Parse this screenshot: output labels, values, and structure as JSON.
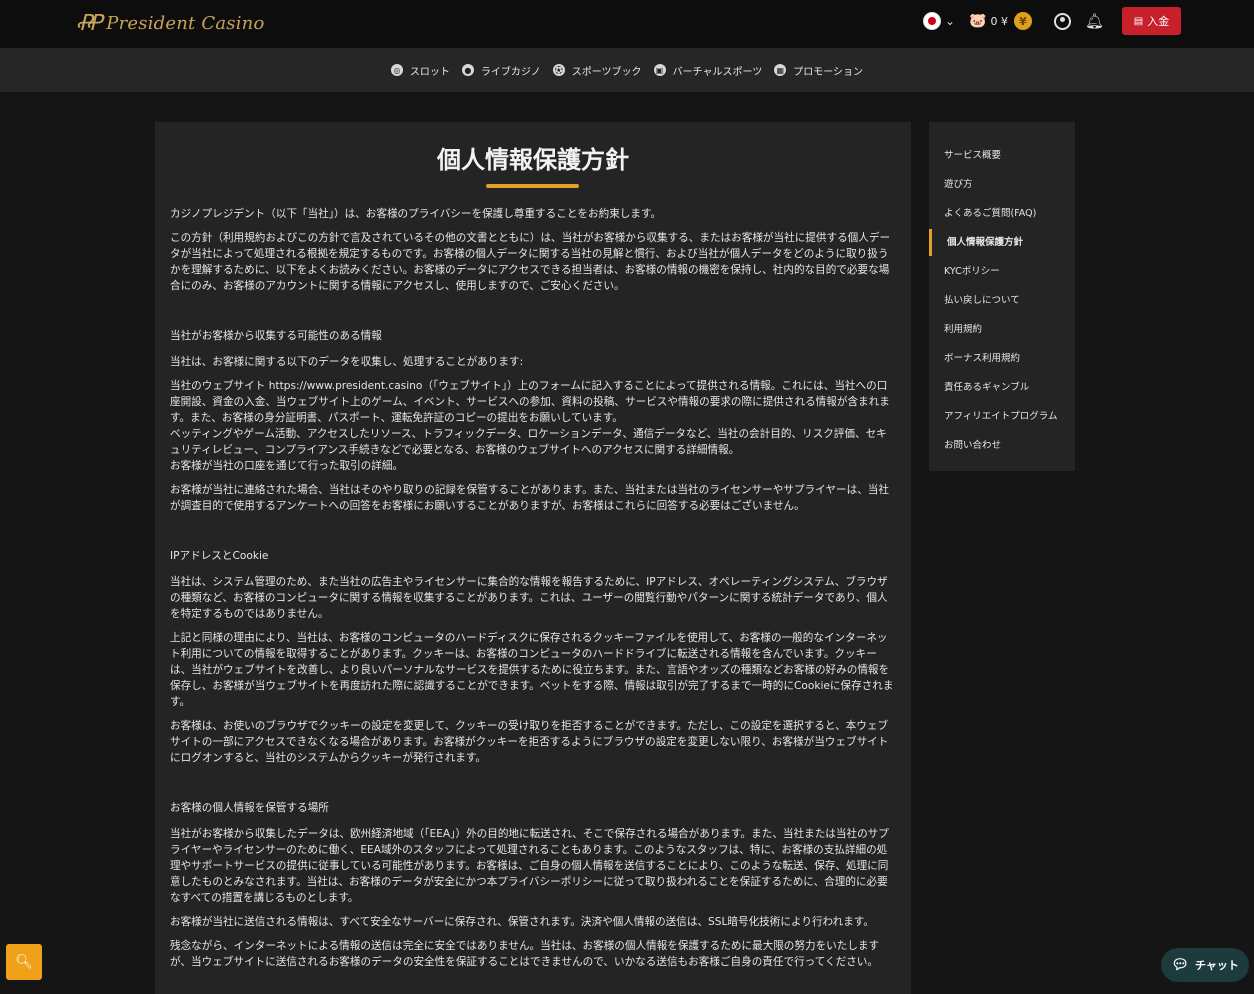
{
  "header": {
    "logo_mark": "ꝒꝒ",
    "logo_text": "President Casino",
    "language_flag": "japan-flag-icon",
    "balance": "0 ¥",
    "coin_symbol": "¥",
    "deposit_label": "入金"
  },
  "nav": {
    "items": [
      {
        "label": "スロット",
        "icon": "slot-icon"
      },
      {
        "label": "ライブカジノ",
        "icon": "live-casino-icon"
      },
      {
        "label": "スポーツブック",
        "icon": "sportsbook-icon"
      },
      {
        "label": "バーチャルスポーツ",
        "icon": "virtual-sports-icon"
      },
      {
        "label": "プロモーション",
        "icon": "promotion-icon"
      }
    ]
  },
  "article": {
    "title": "個人情報保護方針",
    "p1": "カジノプレジデント（以下「当社」）は、お客様のプライバシーを保護し尊重することをお約束します。",
    "p2": "この方針（利用規約およびこの方針で言及されているその他の文書とともに）は、当社がお客様から収集する、またはお客様が当社に提供する個人データが当社によって処理される根拠を規定するものです。お客様の個人データに関する当社の見解と慣行、および当社が個人データをどのように取り扱うかを理解するために、以下をよくお読みください。お客様のデータにアクセスできる担当者は、お客様の情報の機密を保持し、社内的な目的で必要な場合にのみ、お客様のアカウントに関する情報にアクセスし、使用しますので、ご安心ください。",
    "h1": "当社がお客様から収集する可能性のある情報",
    "p3": "当社は、お客様に関する以下のデータを収集し、処理することがあります:",
    "p4a": "当社のウェブサイト https://www.president.casino（「ウェブサイト」）上のフォームに記入することによって提供される情報。これには、当社への口座開設、資金の入金、当ウェブサイト上のゲーム、イベント、サービスへの参加、資料の投稿、サービスや情報の要求の際に提供される情報が含まれます。また、お客様の身分証明書、パスポート、運転免許証のコピーの提出をお願いしています。",
    "p4b": "ベッティングやゲーム活動、アクセスしたリソース、トラフィックデータ、ロケーションデータ、通信データなど、当社の会計目的、リスク評価、セキュリティレビュー、コンプライアンス手続きなどで必要となる、お客様のウェブサイトへのアクセスに関する詳細情報。",
    "p4c": "お客様が当社の口座を通じて行った取引の詳細。",
    "p5": "お客様が当社に連絡された場合、当社はそのやり取りの記録を保管することがあります。また、当社または当社のライセンサーやサプライヤーは、当社が調査目的で使用するアンケートへの回答をお客様にお願いすることがありますが、お客様はこれらに回答する必要はございません。",
    "h2": "IPアドレスとCookie",
    "p6": "当社は、システム管理のため、また当社の広告主やライセンサーに集合的な情報を報告するために、IPアドレス、オペレーティングシステム、ブラウザの種類など、お客様のコンピュータに関する情報を収集することがあります。これは、ユーザーの閲覧行動やパターンに関する統計データであり、個人を特定するものではありません。",
    "p7": "上記と同様の理由により、当社は、お客様のコンピュータのハードディスクに保存されるクッキーファイルを使用して、お客様の一般的なインターネット利用についての情報を取得することがあります。クッキーは、お客様のコンピュータのハードドライブに転送される情報を含んでいます。クッキーは、当社がウェブサイトを改善し、より良いパーソナルなサービスを提供するために役立ちます。また、言語やオッズの種類などお客様の好みの情報を保存し、お客様が当ウェブサイトを再度訪れた際に認識することができます。ベットをする際、情報は取引が完了するまで一時的にCookieに保存されます。",
    "p8": "お客様は、お使いのブラウザでクッキーの設定を変更して、クッキーの受け取りを拒否することができます。ただし、この設定を選択すると、本ウェブサイトの一部にアクセスできなくなる場合があります。お客様がクッキーを拒否するようにブラウザの設定を変更しない限り、お客様が当ウェブサイトにログオンすると、当社のシステムからクッキーが発行されます。",
    "h3": "お客様の個人情報を保管する場所",
    "p9": "当社がお客様から収集したデータは、欧州経済地域（「EEA」）外の目的地に転送され、そこで保存される場合があります。また、当社または当社のサプライヤーやライセンサーのために働く、EEA域外のスタッフによって処理されることもあります。このようなスタッフは、特に、お客様の支払詳細の処理やサポートサービスの提供に従事している可能性があります。お客様は、ご自身の個人情報を送信することにより、このような転送、保存、処理に同意したものとみなされます。当社は、お客様のデータが安全にかつ本プライバシーポリシーに従って取り扱われることを保証するために、合理的に必要なすべての措置を講じるものとします。",
    "p10": "お客様が当社に送信される情報は、すべて安全なサーバーに保存され、保管されます。決済や個人情報の送信は、SSL暗号化技術により行われます。",
    "p11": "残念ながら、インターネットによる情報の送信は完全に安全ではありません。当社は、お客様の個人情報を保護するために最大限の努力をいたしますが、当ウェブサイトに送信されるお客様のデータの安全性を保証することはできませんので、いかなる送信もお客様ご自身の責任で行ってください。"
  },
  "sidebar": {
    "items": [
      {
        "label": "サービス概要"
      },
      {
        "label": "遊び方"
      },
      {
        "label": "よくあるご質問(FAQ)"
      },
      {
        "label": "個人情報保護方針",
        "active": true
      },
      {
        "label": "KYCポリシー"
      },
      {
        "label": "払い戻しについて"
      },
      {
        "label": "利用規約"
      },
      {
        "label": "ボーナス利用規約"
      },
      {
        "label": "責任あるギャンブル"
      },
      {
        "label": "アフィリエイトプログラム"
      },
      {
        "label": "お問い合わせ"
      }
    ]
  },
  "floating": {
    "chat_label": "チャット"
  },
  "colors": {
    "accent": "#e29f2a",
    "deposit": "#c8202b",
    "gold": "#c9a25a"
  }
}
